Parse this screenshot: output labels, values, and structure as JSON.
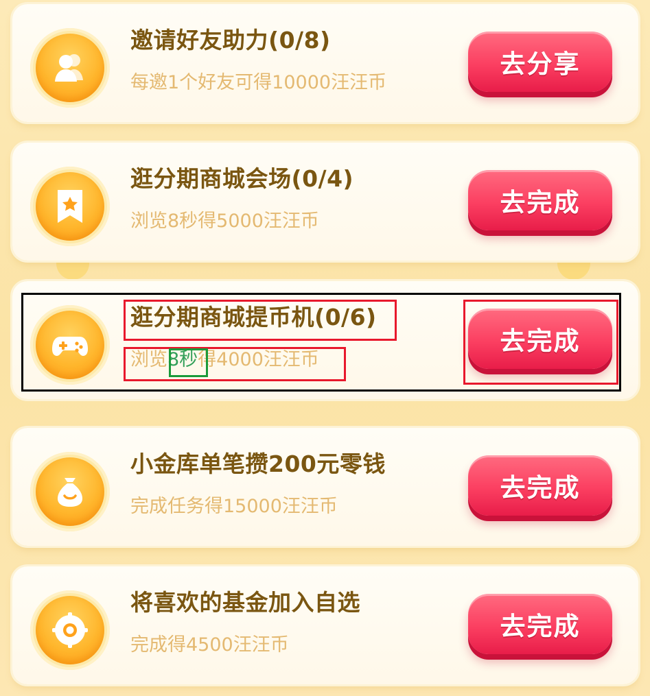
{
  "tasks": [
    {
      "title": "邀请好友助力(0/8)",
      "subtitle": "每邀1个好友可得10000汪汪币",
      "button": "去分享",
      "icon": "friends-icon"
    },
    {
      "title": "逛分期商城会场(0/4)",
      "subtitle": "浏览8秒得5000汪汪币",
      "button": "去完成",
      "icon": "bookmark-star-icon"
    },
    {
      "title": "逛分期商城提币机(0/6)",
      "subtitle_pre": "浏览",
      "subtitle_hl": "8秒",
      "subtitle_post": "得4000汪汪币",
      "button": "去完成",
      "icon": "gamepad-icon"
    },
    {
      "title": "小金库单笔攒200元零钱",
      "subtitle": "完成任务得15000汪汪币",
      "button": "去完成",
      "icon": "money-bag-icon"
    },
    {
      "title": "将喜欢的基金加入自选",
      "subtitle": "完成得4500汪汪币",
      "button": "去完成",
      "icon": "target-icon"
    }
  ],
  "colors": {
    "title": "#7a5611",
    "subtitle": "#e4b971",
    "button": "#fb3f61",
    "icon": "#ffb62c",
    "highlight_black": "#000000",
    "highlight_red": "#e8182c",
    "highlight_green": "#1a9a3a"
  }
}
